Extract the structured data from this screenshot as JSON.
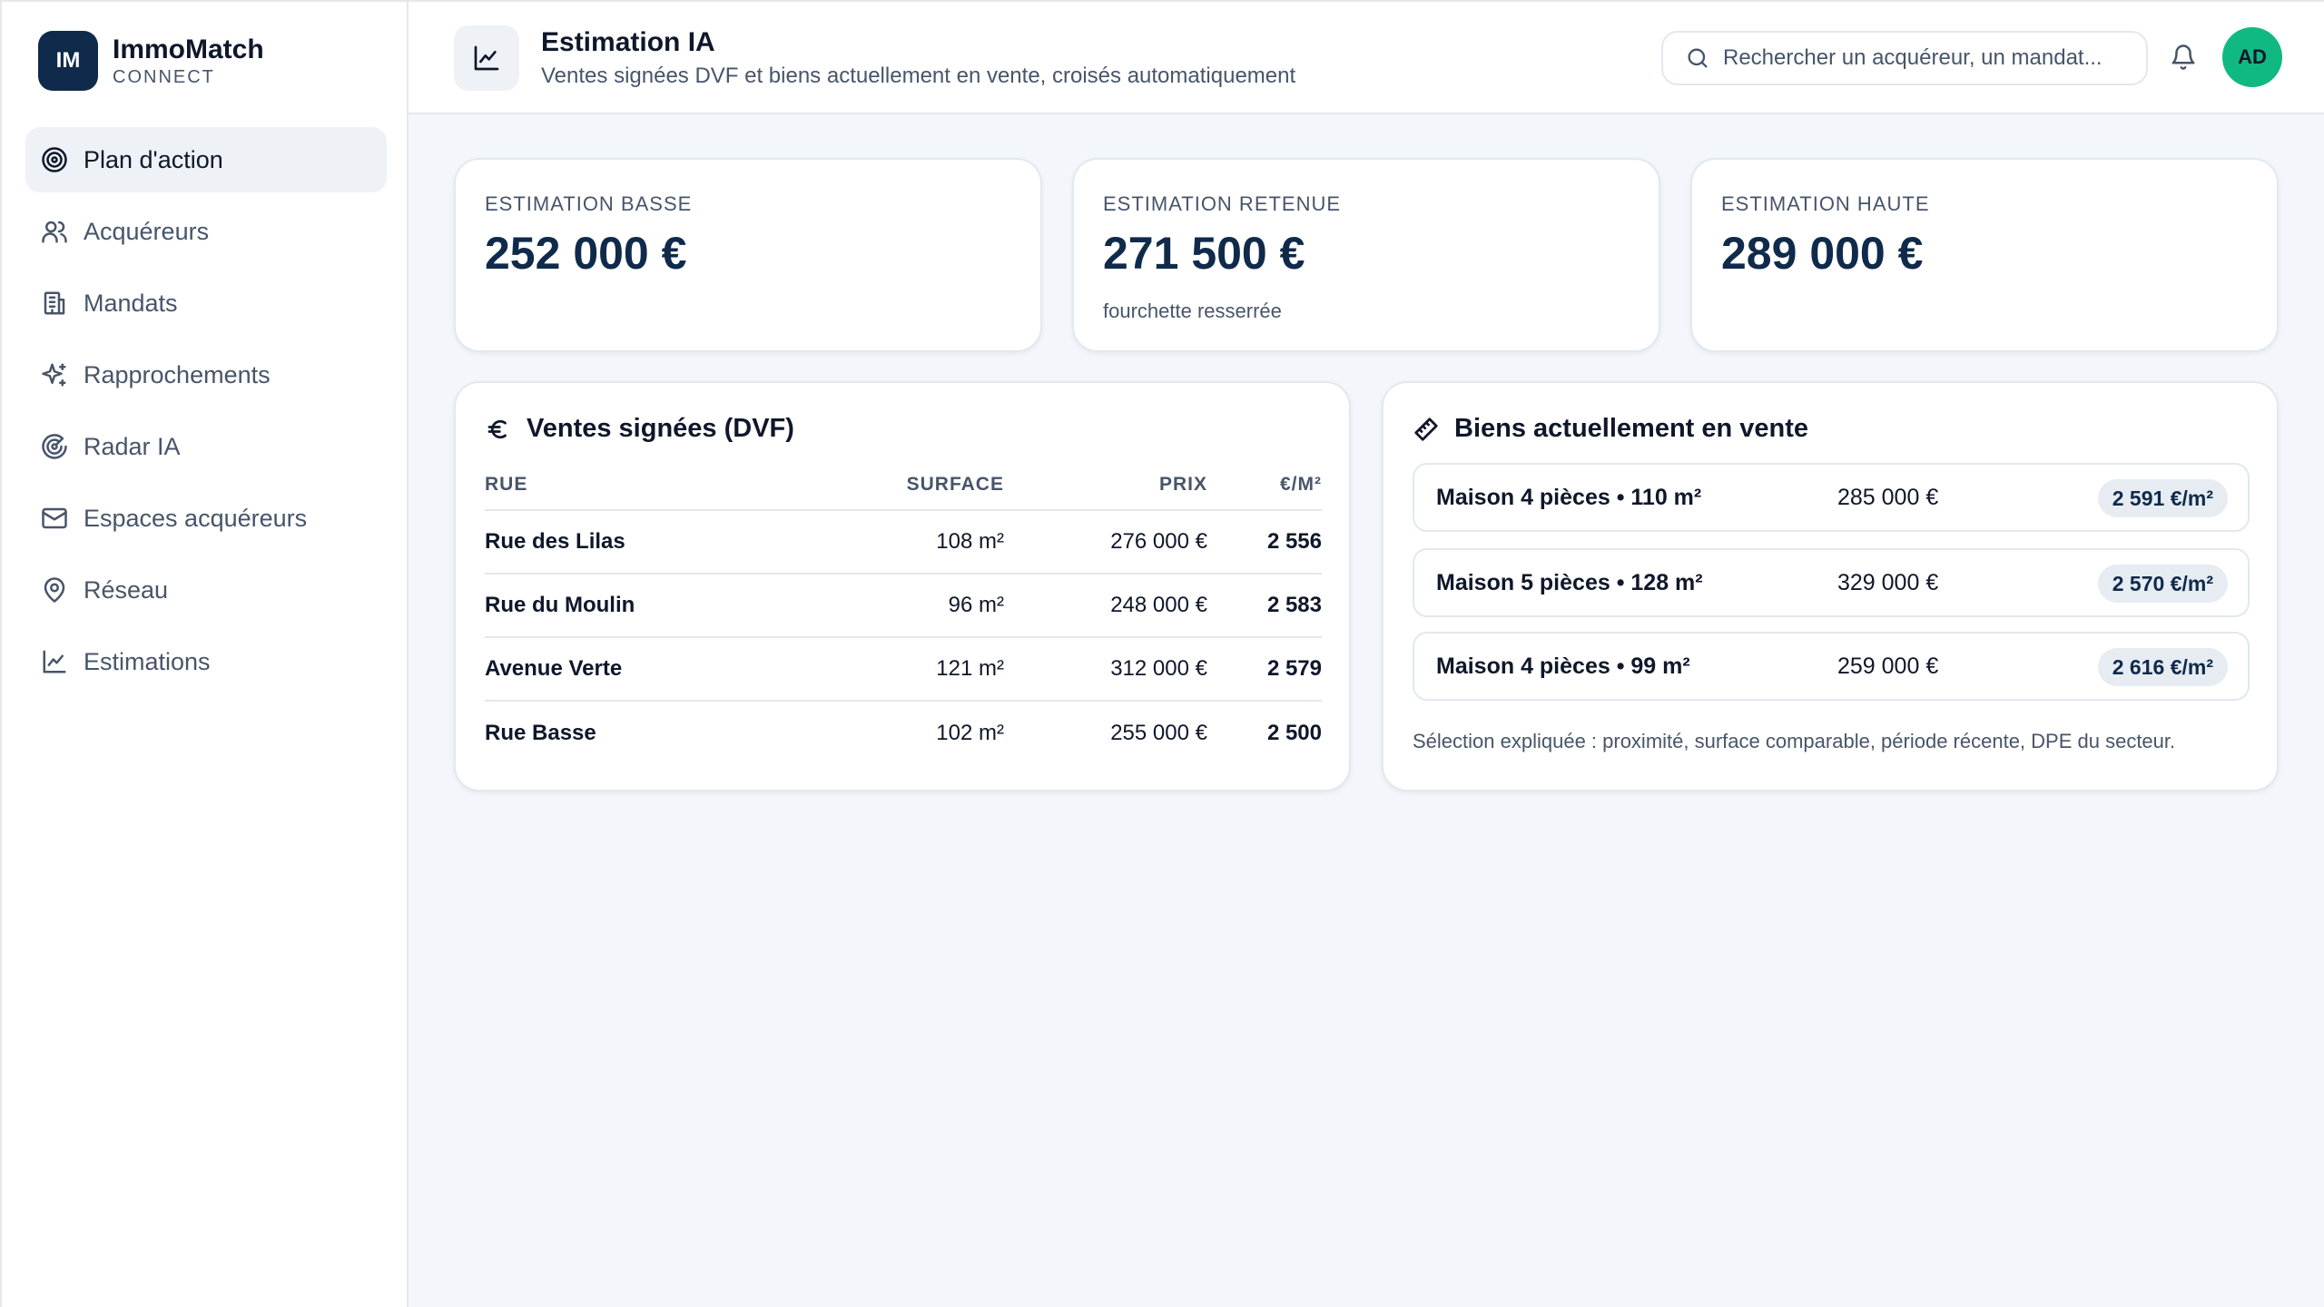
{
  "brand": {
    "logo": "IM",
    "name": "ImmoMatch",
    "sub": "CONNECT"
  },
  "nav": [
    {
      "label": "Plan d'action",
      "icon": "target-icon",
      "active": true
    },
    {
      "label": "Acquéreurs",
      "icon": "users-icon"
    },
    {
      "label": "Mandats",
      "icon": "building-icon"
    },
    {
      "label": "Rapprochements",
      "icon": "sparkles-icon"
    },
    {
      "label": "Radar IA",
      "icon": "radar-icon"
    },
    {
      "label": "Espaces acquéreurs",
      "icon": "mail-icon"
    },
    {
      "label": "Réseau",
      "icon": "map-pin-icon"
    },
    {
      "label": "Estimations",
      "icon": "chart-line-icon"
    }
  ],
  "header": {
    "title": "Estimation IA",
    "subtitle": "Ventes signées DVF et biens actuellement en vente, croisés automatiquement",
    "search_placeholder": "Rechercher un acquéreur, un mandat...",
    "avatar": "AD"
  },
  "kpis": [
    {
      "label": "ESTIMATION BASSE",
      "value": "252 000 €",
      "note": ""
    },
    {
      "label": "ESTIMATION RETENUE",
      "value": "271 500 €",
      "note": "fourchette resserrée"
    },
    {
      "label": "ESTIMATION HAUTE",
      "value": "289 000 €",
      "note": ""
    }
  ],
  "dvf": {
    "title": "Ventes signées (DVF)",
    "columns": [
      "RUE",
      "SURFACE",
      "PRIX",
      "€/M²"
    ],
    "rows": [
      {
        "rue": "Rue des Lilas",
        "surface": "108 m²",
        "prix": "276 000 €",
        "ppm": "2 556"
      },
      {
        "rue": "Rue du Moulin",
        "surface": "96 m²",
        "prix": "248 000 €",
        "ppm": "2 583"
      },
      {
        "rue": "Avenue Verte",
        "surface": "121 m²",
        "prix": "312 000 €",
        "ppm": "2 579"
      },
      {
        "rue": "Rue Basse",
        "surface": "102 m²",
        "prix": "255 000 €",
        "ppm": "2 500"
      }
    ]
  },
  "listings": {
    "title": "Biens actuellement en vente",
    "items": [
      {
        "title": "Maison 4 pièces • 110 m²",
        "price": "285 000 €",
        "badge": "2 591 €/m²"
      },
      {
        "title": "Maison 5 pièces • 128 m²",
        "price": "329 000 €",
        "badge": "2 570 €/m²"
      },
      {
        "title": "Maison 4 pièces • 99 m²",
        "price": "259 000 €",
        "badge": "2 616 €/m²"
      }
    ],
    "note": "Sélection expliquée : proximité, surface comparable, période récente, DPE du secteur."
  },
  "colors": {
    "brand": "#0f2a4a",
    "avatar": "#10b981",
    "background": "#f3f7fb"
  }
}
